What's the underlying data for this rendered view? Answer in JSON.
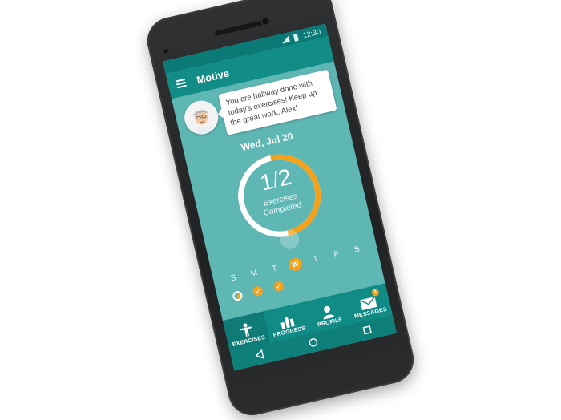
{
  "status_bar": {
    "time": "12:30"
  },
  "app": {
    "title": "Motive"
  },
  "coach_message": "You are halfway done with today's exercises! Keep up the great work, Alex!",
  "date": "Wed, Jul 20",
  "progress": {
    "fraction_text": "1/2",
    "label_line1": "Exercises",
    "label_line2": "Completed",
    "completed": 1,
    "total": 2,
    "ring_fill": 0.5
  },
  "week": {
    "days": [
      {
        "letter": "S",
        "state": "partial"
      },
      {
        "letter": "M",
        "state": "done"
      },
      {
        "letter": "T",
        "state": "done"
      },
      {
        "letter": "W",
        "state": "today"
      },
      {
        "letter": "T",
        "state": "none"
      },
      {
        "letter": "F",
        "state": "none"
      },
      {
        "letter": "S",
        "state": "none"
      }
    ]
  },
  "bottom_nav": {
    "tabs": [
      {
        "label": "EXERCISES",
        "icon": "person-exercise-icon"
      },
      {
        "label": "PROGRESS",
        "icon": "bar-chart-icon"
      },
      {
        "label": "PROFILE",
        "icon": "person-icon"
      },
      {
        "label": "MESSAGES",
        "icon": "envelope-icon",
        "badge": "1"
      }
    ]
  },
  "colors": {
    "teal": "#5fb7b4",
    "dark_teal": "#128c86",
    "orange": "#f5a11a"
  }
}
